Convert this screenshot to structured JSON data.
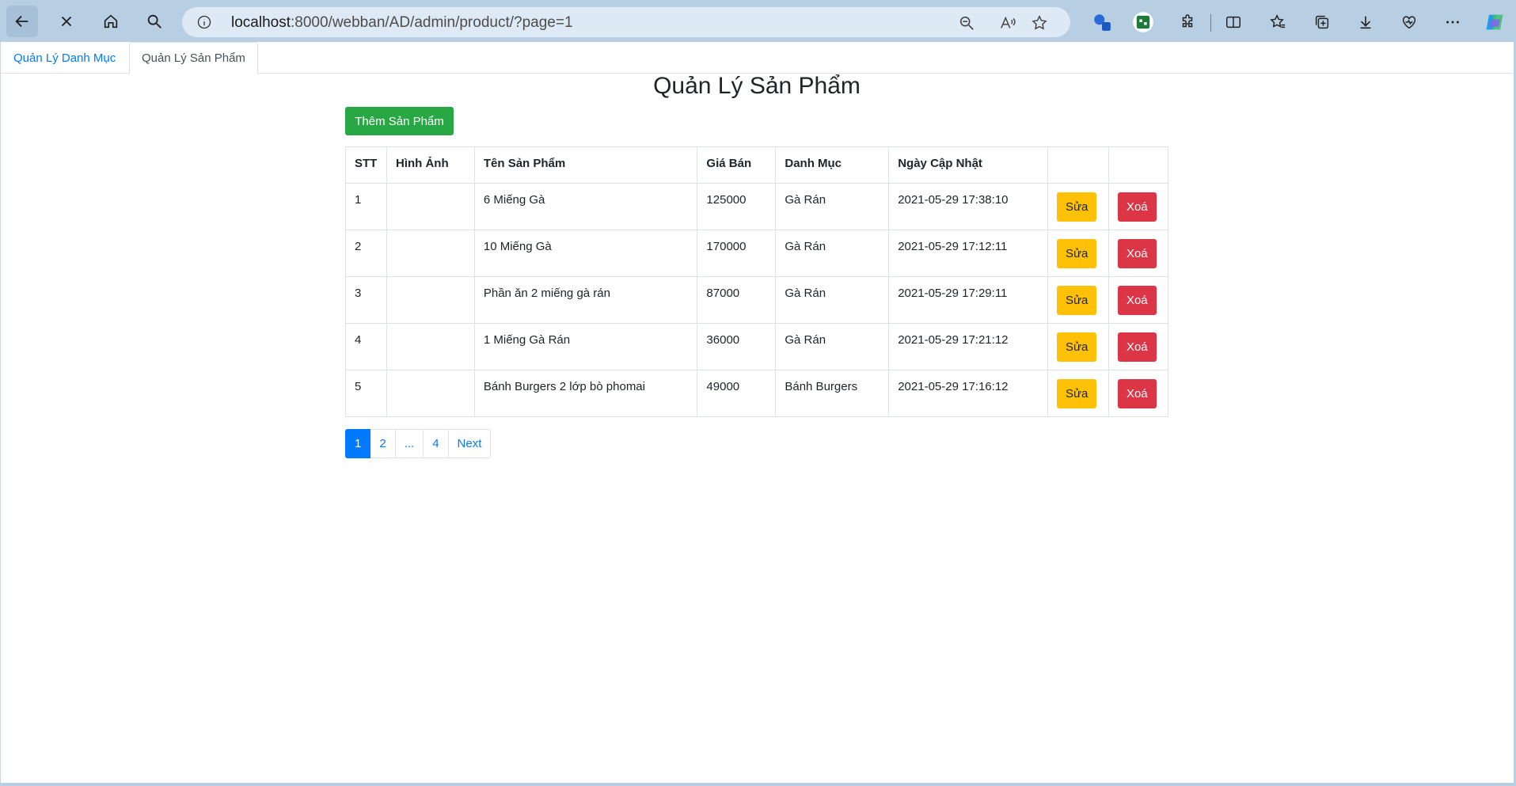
{
  "browser": {
    "url_host": "localhost",
    "url_path": ":8000/webban/AD/admin/product/?page=1"
  },
  "tabs": [
    {
      "label": "Quản Lý Danh Mục",
      "active": false
    },
    {
      "label": "Quản Lý Sản Phẩm",
      "active": true
    }
  ],
  "page": {
    "title": "Quản Lý Sản Phẩm",
    "add_button": "Thêm Sản Phẩm"
  },
  "table": {
    "headers": [
      "STT",
      "Hình Ảnh",
      "Tên Sản Phẩm",
      "Giá Bán",
      "Danh Mục",
      "Ngày Cập Nhật",
      "",
      ""
    ],
    "edit_label": "Sửa",
    "delete_label": "Xoá",
    "rows": [
      {
        "stt": "1",
        "image": "",
        "name": "6 Miếng Gà",
        "price": "125000",
        "category": "Gà Rán",
        "updated": "2021-05-29 17:38:10"
      },
      {
        "stt": "2",
        "image": "",
        "name": "10 Miếng Gà",
        "price": "170000",
        "category": "Gà Rán",
        "updated": "2021-05-29 17:12:11"
      },
      {
        "stt": "3",
        "image": "",
        "name": "Phần ăn 2 miếng gà rán",
        "price": "87000",
        "category": "Gà Rán",
        "updated": "2021-05-29 17:29:11"
      },
      {
        "stt": "4",
        "image": "",
        "name": "1 Miếng Gà Rán",
        "price": "36000",
        "category": "Gà Rán",
        "updated": "2021-05-29 17:21:12"
      },
      {
        "stt": "5",
        "image": "",
        "name": "Bánh Burgers 2 lớp bò phomai",
        "price": "49000",
        "category": "Bánh Burgers",
        "updated": "2021-05-29 17:16:12"
      }
    ]
  },
  "pagination": {
    "pages": [
      "1",
      "2",
      "...",
      "4"
    ],
    "active": "1",
    "next_label": "Next"
  },
  "colors": {
    "primary": "#007bff",
    "success": "#28a745",
    "warning": "#ffc107",
    "danger": "#dc3545",
    "browser_frame": "#b8cfe3"
  }
}
